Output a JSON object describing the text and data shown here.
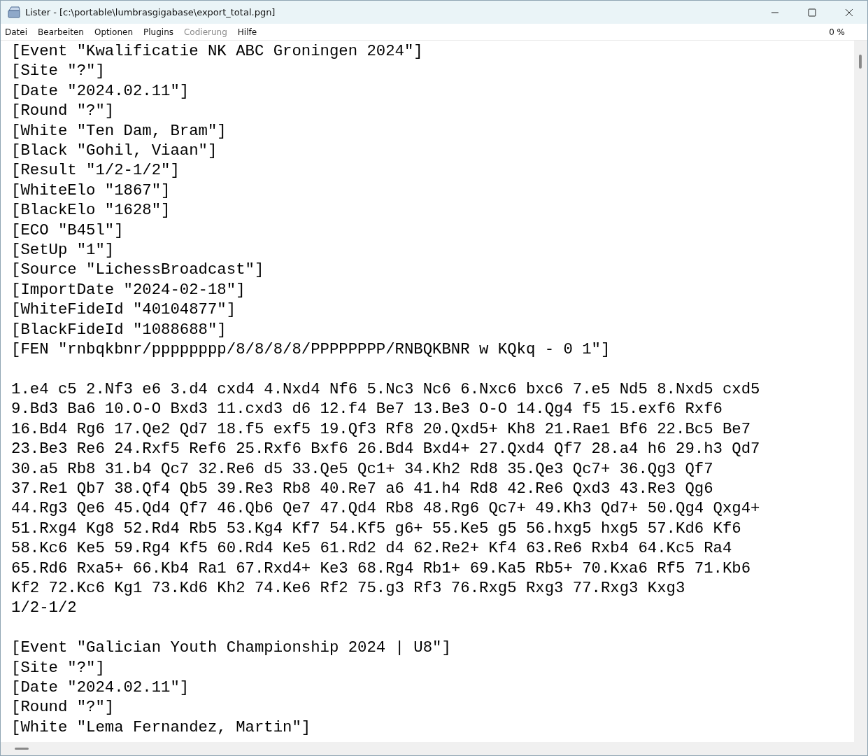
{
  "window": {
    "title": "Lister - [c:\\portable\\lumbrasgigabase\\export_total.pgn]"
  },
  "menu": [
    {
      "label": "Datei",
      "disabled": false
    },
    {
      "label": "Bearbeiten",
      "disabled": false
    },
    {
      "label": "Optionen",
      "disabled": false
    },
    {
      "label": "Plugins",
      "disabled": false
    },
    {
      "label": "Codierung",
      "disabled": true
    },
    {
      "label": "Hilfe",
      "disabled": false
    }
  ],
  "percent": "0 %",
  "blocks": [
    {
      "lines": [
        "[Event \"Kwalificatie NK ABC Groningen 2024\"]",
        "[Site \"?\"]",
        "[Date \"2024.02.11\"]",
        "[Round \"?\"]",
        "[White \"Ten Dam, Bram\"]",
        "[Black \"Gohil, Viaan\"]",
        "[Result \"1/2-1/2\"]",
        "[WhiteElo \"1867\"]",
        "[BlackElo \"1628\"]",
        "[ECO \"B45l\"]",
        "[SetUp \"1\"]",
        "[Source \"LichessBroadcast\"]",
        "[ImportDate \"2024-02-18\"]",
        "[WhiteFideId \"40104877\"]",
        "[BlackFideId \"1088688\"]",
        "[FEN \"rnbqkbnr/pppppppp/8/8/8/8/PPPPPPPP/RNBQKBNR w KQkq - 0 1\"]"
      ]
    },
    {
      "lines": [
        "1.e4 c5 2.Nf3 e6 3.d4 cxd4 4.Nxd4 Nf6 5.Nc3 Nc6 6.Nxc6 bxc6 7.e5 Nd5 8.Nxd5 cxd5",
        "9.Bd3 Ba6 10.O-O Bxd3 11.cxd3 d6 12.f4 Be7 13.Be3 O-O 14.Qg4 f5 15.exf6 Rxf6",
        "16.Bd4 Rg6 17.Qe2 Qd7 18.f5 exf5 19.Qf3 Rf8 20.Qxd5+ Kh8 21.Rae1 Bf6 22.Bc5 Be7",
        "23.Be3 Re6 24.Rxf5 Ref6 25.Rxf6 Bxf6 26.Bd4 Bxd4+ 27.Qxd4 Qf7 28.a4 h6 29.h3 Qd7",
        "30.a5 Rb8 31.b4 Qc7 32.Re6 d5 33.Qe5 Qc1+ 34.Kh2 Rd8 35.Qe3 Qc7+ 36.Qg3 Qf7",
        "37.Re1 Qb7 38.Qf4 Qb5 39.Re3 Rb8 40.Re7 a6 41.h4 Rd8 42.Re6 Qxd3 43.Re3 Qg6",
        "44.Rg3 Qe6 45.Qd4 Qf7 46.Qb6 Qe7 47.Qd4 Rb8 48.Rg6 Qc7+ 49.Kh3 Qd7+ 50.Qg4 Qxg4+",
        "51.Rxg4 Kg8 52.Rd4 Rb5 53.Kg4 Kf7 54.Kf5 g6+ 55.Ke5 g5 56.hxg5 hxg5 57.Kd6 Kf6",
        "58.Kc6 Ke5 59.Rg4 Kf5 60.Rd4 Ke5 61.Rd2 d4 62.Re2+ Kf4 63.Re6 Rxb4 64.Kc5 Ra4",
        "65.Rd6 Rxa5+ 66.Kb4 Ra1 67.Rxd4+ Ke3 68.Rg4 Rb1+ 69.Ka5 Rb5+ 70.Kxa6 Rf5 71.Kb6",
        "Kf2 72.Kc6 Kg1 73.Kd6 Kh2 74.Ke6 Rf2 75.g3 Rf3 76.Rxg5 Rxg3 77.Rxg3 Kxg3",
        "1/2-1/2"
      ]
    },
    {
      "lines": [
        "[Event \"Galician Youth Championship 2024 | U8\"]",
        "[Site \"?\"]",
        "[Date \"2024.02.11\"]",
        "[Round \"?\"]",
        "[White \"Lema Fernandez, Martin\"]"
      ]
    }
  ]
}
